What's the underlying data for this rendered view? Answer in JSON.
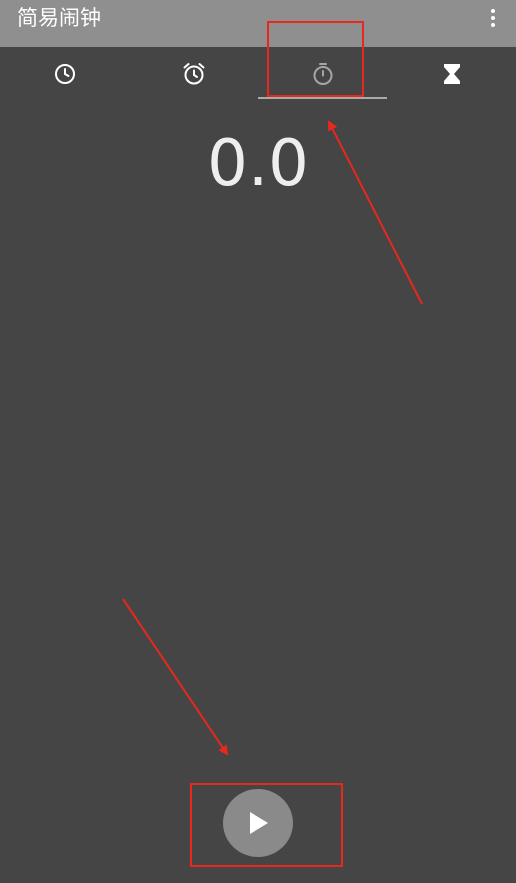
{
  "app": {
    "title": "简易闹钟",
    "menu_icon": "more-vertical-icon"
  },
  "tabs": [
    {
      "icon": "clock-icon",
      "selected": false
    },
    {
      "icon": "alarm-icon",
      "selected": false
    },
    {
      "icon": "stopwatch-icon",
      "selected": true
    },
    {
      "icon": "hourglass-icon",
      "selected": false
    }
  ],
  "stopwatch": {
    "elapsed": "0.0"
  },
  "controls": {
    "play_icon": "play-icon"
  },
  "colors": {
    "titlebar": "#8f8f8f",
    "background": "#454545",
    "annotation": "#e8281e"
  }
}
